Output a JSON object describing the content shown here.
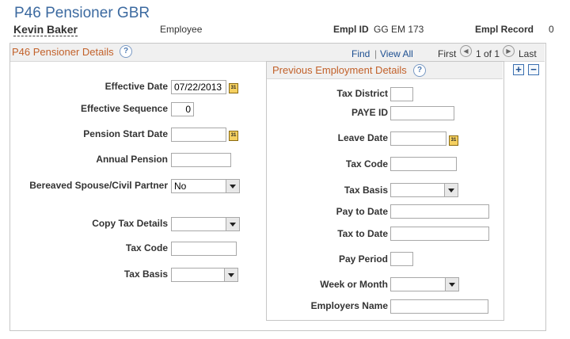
{
  "page": {
    "title": "P46 Pensioner GBR"
  },
  "employee": {
    "name": "Kevin Baker",
    "type": "Employee",
    "empl_id_label": "Empl ID",
    "empl_id": "GG EM 173",
    "empl_record_label": "Empl Record",
    "empl_record": "0"
  },
  "section": {
    "title": "P46 Pensioner Details",
    "find": "Find",
    "separator": "|",
    "view_all": "View All",
    "first": "First",
    "page_info": "1 of 1",
    "last": "Last",
    "add": "+",
    "remove": "−"
  },
  "icons": {
    "help": "?",
    "prev": "◀",
    "next": "▶",
    "calendar": "31"
  },
  "fields": {
    "effective_date": {
      "label": "Effective Date",
      "value": "07/22/2013"
    },
    "effective_sequence": {
      "label": "Effective Sequence",
      "value": "0"
    },
    "pension_start_date": {
      "label": "Pension Start Date",
      "value": ""
    },
    "annual_pension": {
      "label": "Annual Pension",
      "value": ""
    },
    "bereaved": {
      "label": "Bereaved Spouse/Civil Partner",
      "value": "No"
    },
    "copy_tax_details": {
      "label": "Copy Tax Details",
      "value": ""
    },
    "tax_code": {
      "label": "Tax Code",
      "value": ""
    },
    "tax_basis": {
      "label": "Tax Basis",
      "value": ""
    }
  },
  "previous": {
    "title": "Previous Employment Details",
    "tax_district": {
      "label": "Tax District",
      "value": ""
    },
    "paye_id": {
      "label": "PAYE ID",
      "value": ""
    },
    "leave_date": {
      "label": "Leave Date",
      "value": ""
    },
    "tax_code": {
      "label": "Tax Code",
      "value": ""
    },
    "tax_basis": {
      "label": "Tax Basis",
      "value": ""
    },
    "pay_to_date": {
      "label": "Pay to Date",
      "value": ""
    },
    "tax_to_date": {
      "label": "Tax to Date",
      "value": ""
    },
    "pay_period": {
      "label": "Pay Period",
      "value": ""
    },
    "week_or_month": {
      "label": "Week or Month",
      "value": ""
    },
    "employers_name": {
      "label": "Employers Name",
      "value": ""
    }
  }
}
